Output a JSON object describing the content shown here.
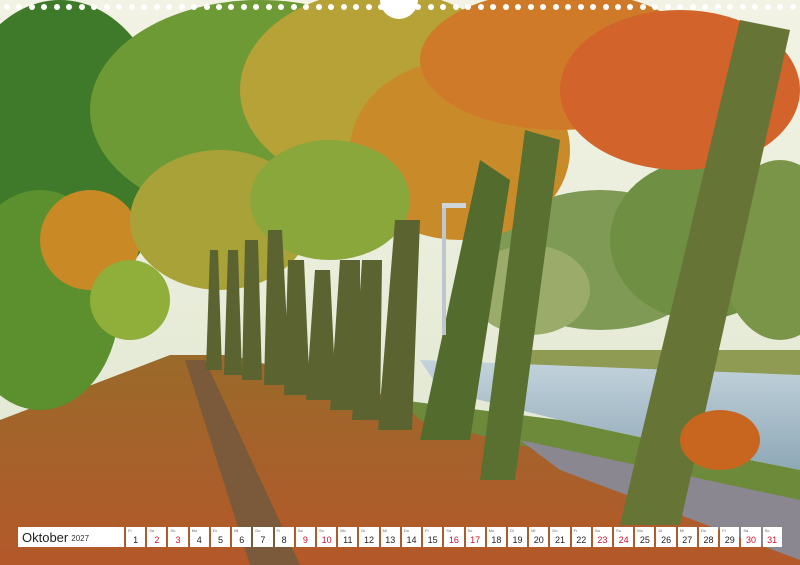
{
  "calendar": {
    "month": "Oktober",
    "year": "2027",
    "days": [
      {
        "wd": "Fr",
        "num": "1"
      },
      {
        "wd": "Sa",
        "num": "2"
      },
      {
        "wd": "So",
        "num": "3"
      },
      {
        "wd": "Mo",
        "num": "4"
      },
      {
        "wd": "Di",
        "num": "5"
      },
      {
        "wd": "Mi",
        "num": "6"
      },
      {
        "wd": "Do",
        "num": "7"
      },
      {
        "wd": "Fr",
        "num": "8"
      },
      {
        "wd": "Sa",
        "num": "9"
      },
      {
        "wd": "So",
        "num": "10"
      },
      {
        "wd": "Mo",
        "num": "11"
      },
      {
        "wd": "Di",
        "num": "12"
      },
      {
        "wd": "Mi",
        "num": "13"
      },
      {
        "wd": "Do",
        "num": "14"
      },
      {
        "wd": "Fr",
        "num": "15"
      },
      {
        "wd": "Sa",
        "num": "16"
      },
      {
        "wd": "So",
        "num": "17"
      },
      {
        "wd": "Mo",
        "num": "18"
      },
      {
        "wd": "Di",
        "num": "19"
      },
      {
        "wd": "Mi",
        "num": "20"
      },
      {
        "wd": "Do",
        "num": "21"
      },
      {
        "wd": "Fr",
        "num": "22"
      },
      {
        "wd": "Sa",
        "num": "23"
      },
      {
        "wd": "So",
        "num": "24"
      },
      {
        "wd": "Mo",
        "num": "25"
      },
      {
        "wd": "Di",
        "num": "26"
      },
      {
        "wd": "Mi",
        "num": "27"
      },
      {
        "wd": "Do",
        "num": "28"
      },
      {
        "wd": "Fr",
        "num": "29"
      },
      {
        "wd": "Sa",
        "num": "30"
      },
      {
        "wd": "So",
        "num": "31"
      }
    ],
    "weekend_color": "#d1122a"
  },
  "photo": {
    "palette": {
      "sky": "#e6ecd8",
      "foliage_green": "#4f8a2c",
      "foliage_yellow": "#d8b72a",
      "foliage_orange": "#d86a1f",
      "leaves_ground": "#b5642c",
      "water": "#a9bcc9",
      "trunk": "#5b6330"
    }
  }
}
